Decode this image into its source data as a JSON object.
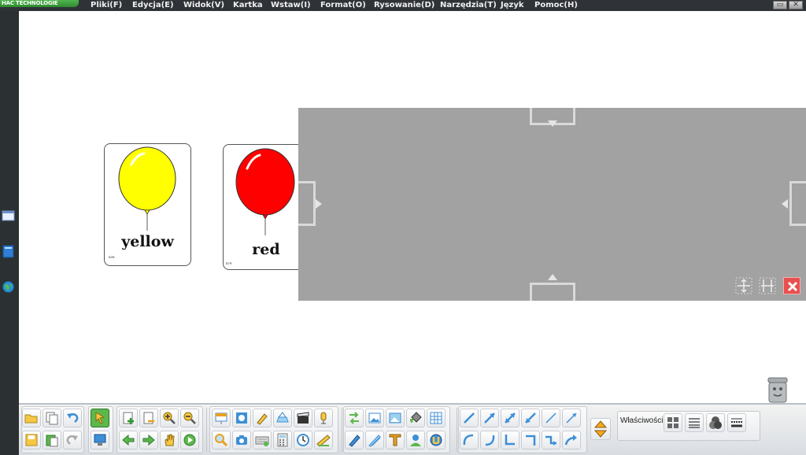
{
  "app": {
    "brand": "HAC TECHNOLOGIE"
  },
  "menu": {
    "items": [
      {
        "label": "Pliki(F)"
      },
      {
        "label": "Edycja(E)"
      },
      {
        "label": "Widok(V)"
      },
      {
        "label": "Kartka"
      },
      {
        "label": "Wstaw(I)"
      },
      {
        "label": "Format(O)"
      },
      {
        "label": "Rysowanie(D)"
      },
      {
        "label": "Narzędzia(T)"
      },
      {
        "label": "Język"
      },
      {
        "label": "Pomoc(H)"
      }
    ]
  },
  "window_controls": {
    "restore": "▭",
    "close": "✕"
  },
  "cards": [
    {
      "word": "yellow",
      "code": "B2B",
      "balloon_color": "#ffff00"
    },
    {
      "word": "red",
      "code": "B7R",
      "balloon_color": "#ff0000"
    }
  ],
  "toolbar": {
    "properties_label": "Właściwości:"
  },
  "colors": {
    "menubar": "#2f3337",
    "overlay": "#a2a2a2",
    "close_red": "#e85050",
    "accent_green": "#5cb84a",
    "icon_blue": "#3d8fd6"
  }
}
